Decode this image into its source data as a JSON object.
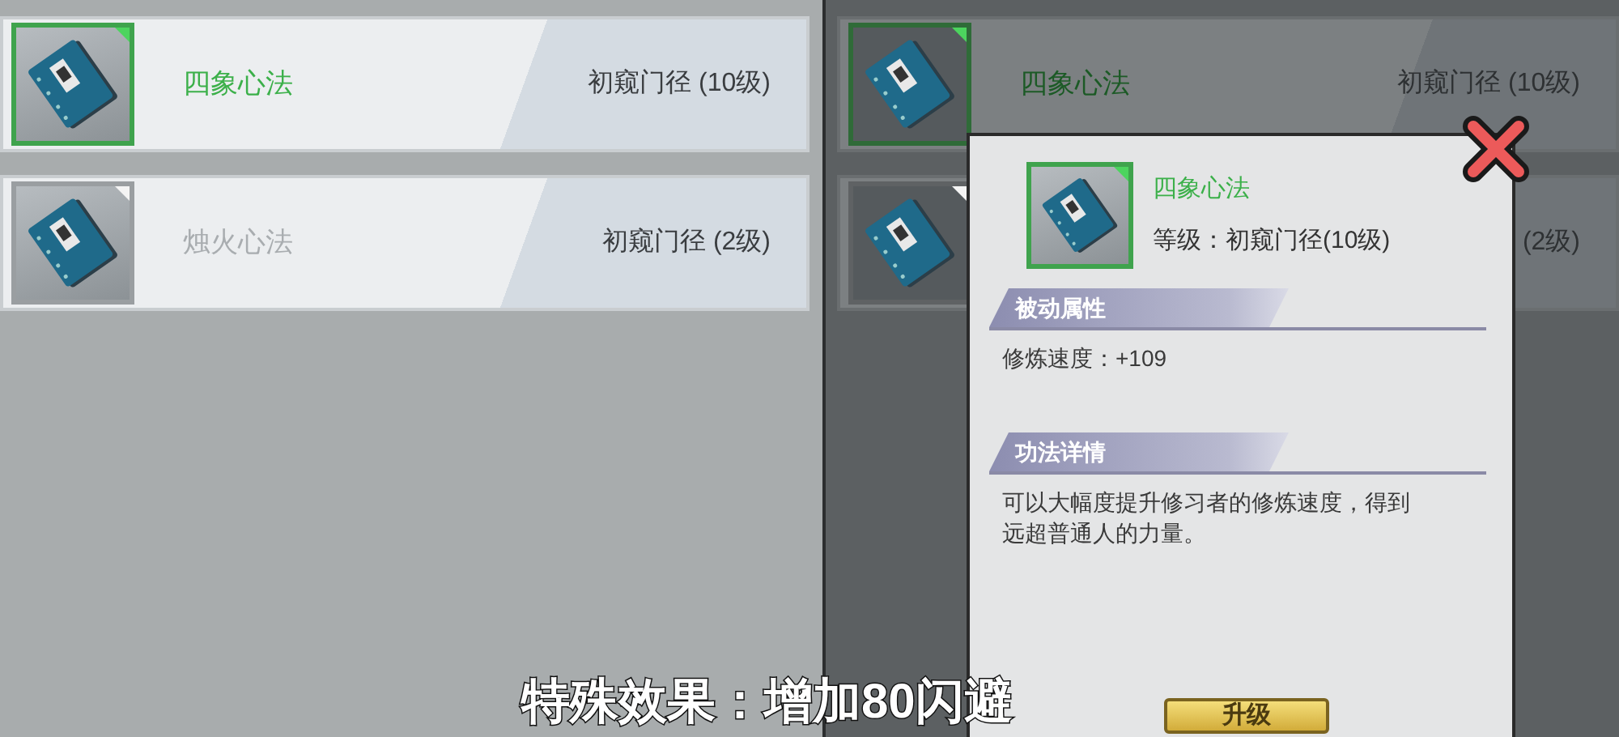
{
  "list_panel": {
    "items": [
      {
        "name": "四象心法",
        "level": "初窥门径 (10级)",
        "selected": true
      },
      {
        "name": "烛火心法",
        "level": "初窥门径 (2级)",
        "selected": false
      }
    ]
  },
  "dimmed_panel": {
    "items": [
      {
        "name": "四象心法",
        "level": "初窥门径 (10级)",
        "selected": true
      },
      {
        "level": "(2级)",
        "selected": false
      }
    ]
  },
  "detail_popup": {
    "name": "四象心法",
    "level_text": "等级：初窥门径(10级)",
    "sections": [
      {
        "title": "被动属性",
        "text": "修炼速度：+109"
      },
      {
        "title": "功法详情",
        "text": "可以大幅度提升修习者的修炼速度，得到远超普通人的力量。"
      }
    ],
    "button": "升级"
  },
  "subtitle": "特殊效果：增加80闪避"
}
